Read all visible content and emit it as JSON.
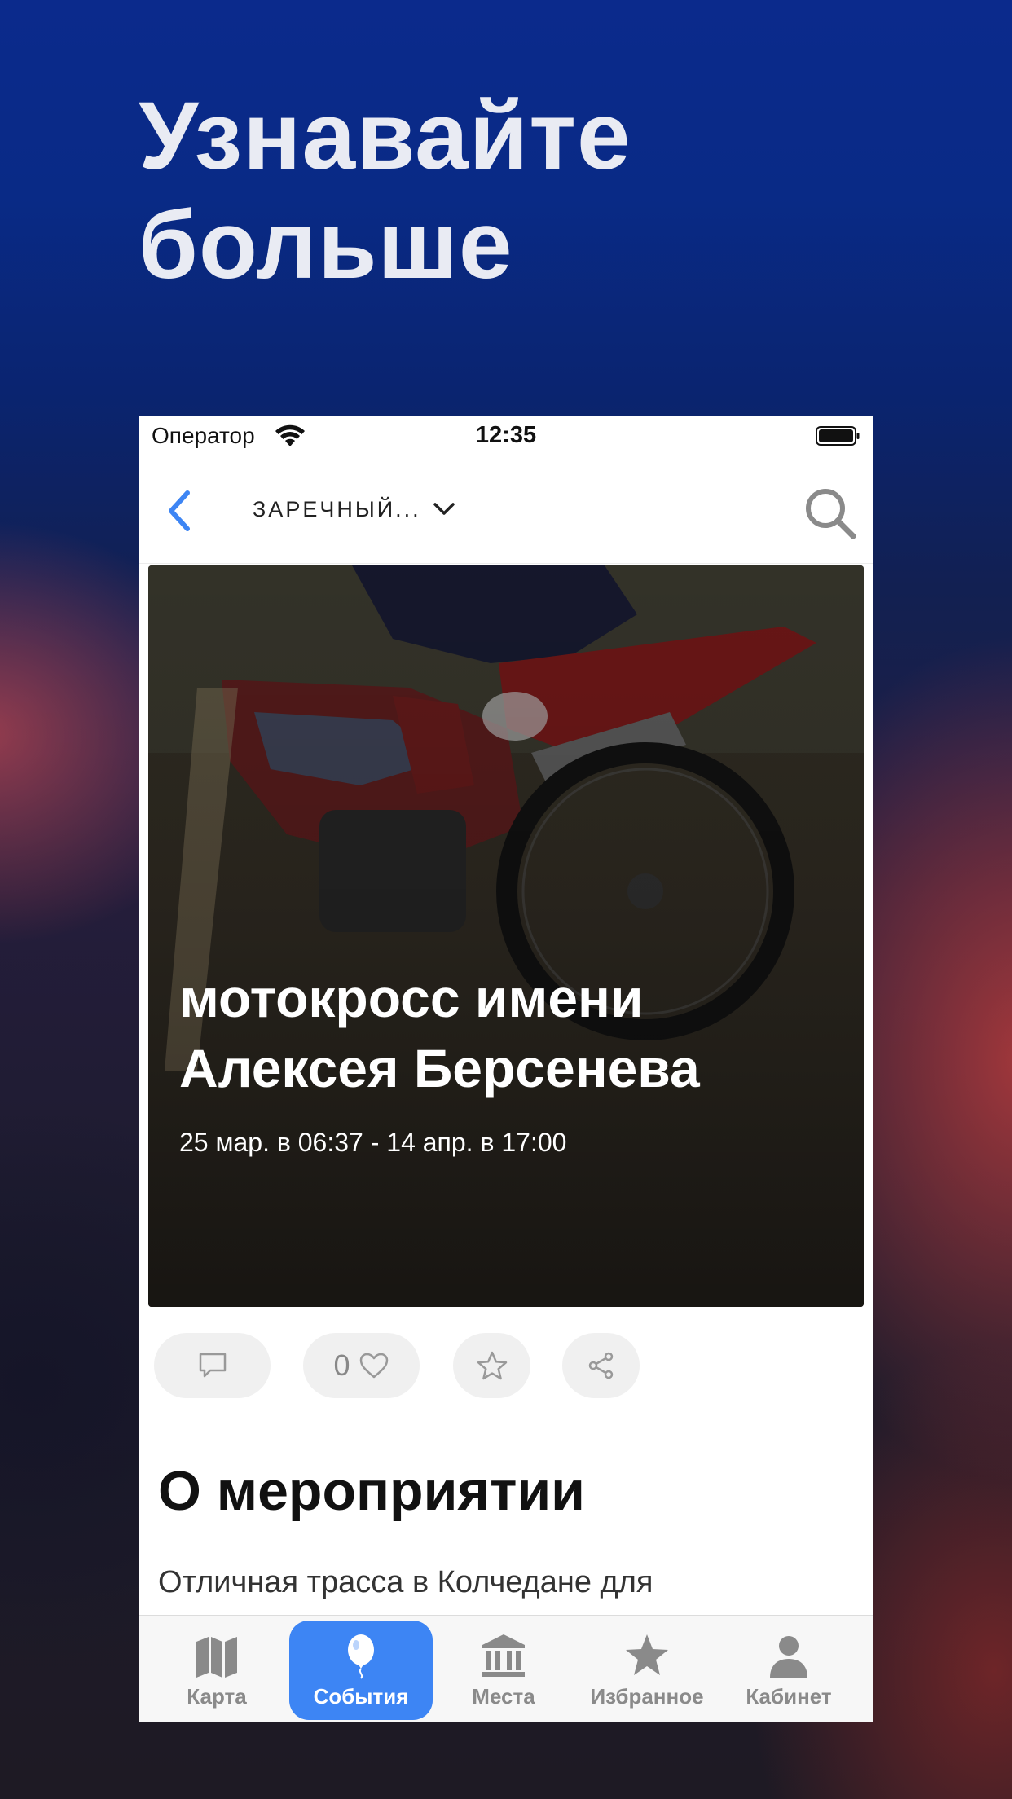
{
  "promo": {
    "headline_line1": "Узнавайте",
    "headline_line2": "больше"
  },
  "status_bar": {
    "carrier": "Оператор",
    "time": "12:35"
  },
  "nav": {
    "city": "ЗАРЕЧНЫЙ..."
  },
  "event": {
    "title": "мотокросс имени Алексея Берсенева",
    "dates": "25 мар. в 06:37 - 14 апр. в 17:00",
    "likes": "0"
  },
  "about": {
    "title": "О мероприятии",
    "text": "Отличная трасса в Колчедане для"
  },
  "tabs": [
    {
      "label": "Карта",
      "icon": "map-icon"
    },
    {
      "label": "События",
      "icon": "balloon-icon",
      "active": true
    },
    {
      "label": "Места",
      "icon": "museum-icon"
    },
    {
      "label": "Избранное",
      "icon": "star-icon"
    },
    {
      "label": "Кабинет",
      "icon": "person-icon"
    }
  ],
  "colors": {
    "accent": "#3d85f4",
    "background_top": "#0b2a8c",
    "tab_inactive": "#8a8a8a"
  }
}
